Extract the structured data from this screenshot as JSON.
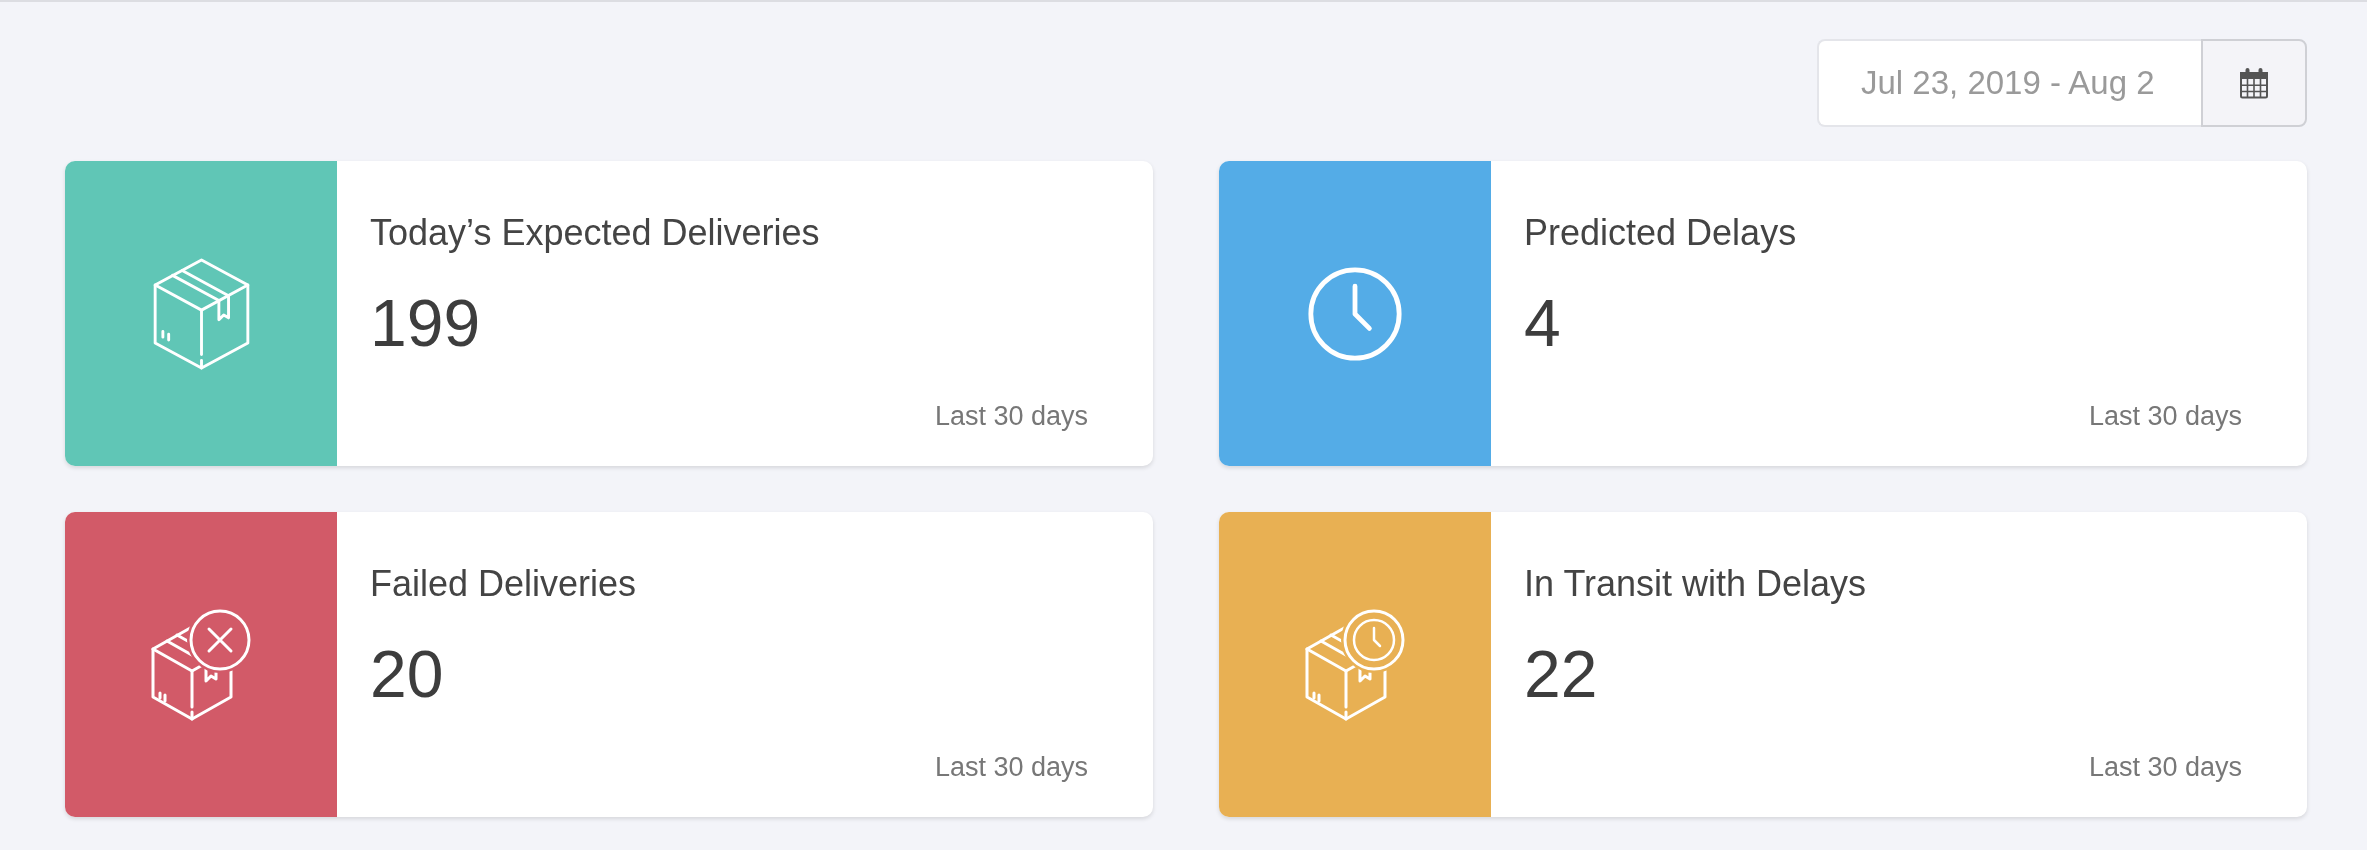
{
  "date_range": {
    "value": "Jul 23, 2019 - Aug 2"
  },
  "cards": [
    {
      "title": "Today’s Expected Deliveries",
      "value": "199",
      "period": "Last 30 days",
      "color": "#60c6b6"
    },
    {
      "title": "Predicted Delays",
      "value": "4",
      "period": "Last 30 days",
      "color": "#54ace7"
    },
    {
      "title": "Failed Deliveries",
      "value": "20",
      "period": "Last 30 days",
      "color": "#d25a68"
    },
    {
      "title": "In Transit with Delays",
      "value": "22",
      "period": "Last 30 days",
      "color": "#e8b053"
    }
  ]
}
